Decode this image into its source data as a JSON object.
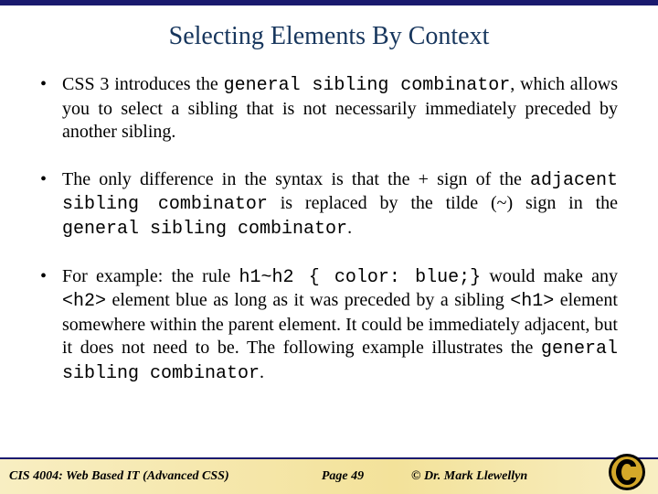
{
  "title": "Selecting Elements By Context",
  "bullets": {
    "b1": {
      "t1": "CSS 3 introduces the ",
      "code1": "general sibling combinator",
      "t2": ", which allows you to select a sibling that is not necessarily immediately preceded by another sibling."
    },
    "b2": {
      "t1": "The only difference in the syntax is that the + sign of the ",
      "code1": "adjacent sibling combinator",
      "t2": " is replaced by the tilde (~) sign in the ",
      "code2": "general sibling combinator",
      "t3": "."
    },
    "b3": {
      "t1": "For example: the rule ",
      "code1": "h1~h2 { color: blue;}",
      "t2": "  would make any ",
      "code2": "<h2>",
      "t3": "  element blue as long as it was preceded by a sibling ",
      "code3": "<h1>",
      "t4": "  element somewhere within the parent element.  It could be immediately adjacent, but it does not need to be.  The following example illustrates the ",
      "code4": "general sibling combinator",
      "t5": "."
    }
  },
  "footer": {
    "course": "CIS 4004: Web Based IT (Advanced CSS)",
    "page": "Page 49",
    "copyright": "© Dr. Mark Llewellyn"
  }
}
